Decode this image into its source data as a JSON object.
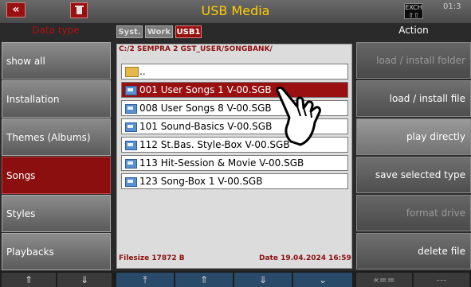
{
  "window": {
    "title": "USB Media",
    "back_label": "«",
    "page_indicator": "EXCH ⇧⇧",
    "clock": "01:3"
  },
  "header": {
    "data_type": "Data type",
    "action": "Action",
    "tabs": [
      "Syst.",
      "Work",
      "USB1"
    ]
  },
  "data_types": [
    {
      "label": "show all",
      "selected": false
    },
    {
      "label": "Installation",
      "selected": false
    },
    {
      "label": "Themes (Albums)",
      "selected": false
    },
    {
      "label": "Songs",
      "selected": true
    },
    {
      "label": "Styles",
      "selected": false
    },
    {
      "label": "Playbacks",
      "selected": false
    }
  ],
  "file_browser": {
    "path": "C:/2 SEMPRA 2 GST_USER/SONGBANK/",
    "parent_label": "..",
    "files": [
      "001 User Songs 1 V-00.SGB",
      "008 User Songs 8 V-00.SGB",
      "101 Sound-Basics V-00.SGB",
      "112 St.Bas. Style-Box V-00.SGB",
      "113 Hit-Session & Movie V-00.SGB",
      "123 Song-Box 1 V-00.SGB"
    ],
    "selected_index": 0,
    "filesize": "Filesize 17872 B",
    "date": "Date 19.04.2024 16:59"
  },
  "actions": [
    {
      "label": "load / install folder",
      "state": "disabled"
    },
    {
      "label": "load / install file",
      "state": "enabled"
    },
    {
      "label": "play directly",
      "state": "highlighted"
    },
    {
      "label": "save selected type",
      "state": "enabled"
    },
    {
      "label": "format drive",
      "state": "disabled"
    },
    {
      "label": "delete file",
      "state": "enabled"
    }
  ],
  "bottom_nav": [
    "⇑",
    "⇓",
    "⤒",
    "⇑",
    "⇓",
    "⌄",
    "«==",
    "---"
  ],
  "colors": {
    "accent_red": "#8c0f0f",
    "title_yellow": "#ffcc00"
  }
}
